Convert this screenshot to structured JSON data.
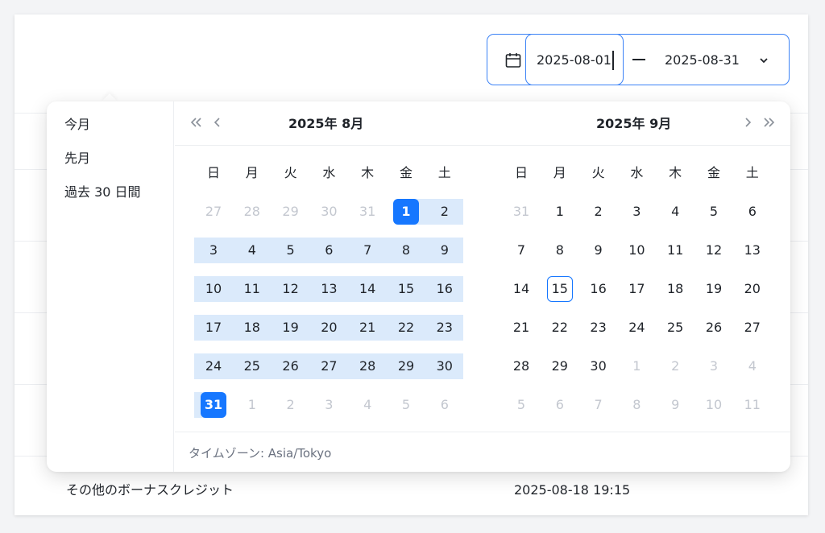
{
  "range_input": {
    "start_value": "2025-08-01",
    "end_value": "2025-08-31"
  },
  "presets": [
    "今月",
    "先月",
    "過去 30 日間"
  ],
  "left_month": {
    "title": "2025年  8月",
    "weekdays": [
      "日",
      "月",
      "火",
      "水",
      "木",
      "金",
      "土"
    ],
    "weeks": [
      [
        "27",
        "28",
        "29",
        "30",
        "31",
        "1",
        "2"
      ],
      [
        "3",
        "4",
        "5",
        "6",
        "7",
        "8",
        "9"
      ],
      [
        "10",
        "11",
        "12",
        "13",
        "14",
        "15",
        "16"
      ],
      [
        "17",
        "18",
        "19",
        "20",
        "21",
        "22",
        "23"
      ],
      [
        "24",
        "25",
        "26",
        "27",
        "28",
        "29",
        "30"
      ],
      [
        "31",
        "1",
        "2",
        "3",
        "4",
        "5",
        "6"
      ]
    ]
  },
  "right_month": {
    "title": "2025年  9月",
    "weekdays": [
      "日",
      "月",
      "火",
      "水",
      "木",
      "金",
      "土"
    ],
    "weeks": [
      [
        "31",
        "1",
        "2",
        "3",
        "4",
        "5",
        "6"
      ],
      [
        "7",
        "8",
        "9",
        "10",
        "11",
        "12",
        "13"
      ],
      [
        "14",
        "15",
        "16",
        "17",
        "18",
        "19",
        "20"
      ],
      [
        "21",
        "22",
        "23",
        "24",
        "25",
        "26",
        "27"
      ],
      [
        "28",
        "29",
        "30",
        "1",
        "2",
        "3",
        "4"
      ],
      [
        "5",
        "6",
        "7",
        "8",
        "9",
        "10",
        "11"
      ]
    ]
  },
  "timezone_label": "タイムゾーン: Asia/Tokyo",
  "background_row": {
    "label": "その他のボーナスクレジット",
    "timestamp": "2025-08-18 19:15"
  },
  "colors": {
    "accent": "#1677ff",
    "range_band": "#dbeafb",
    "muted_text": "#c3c7cf"
  }
}
